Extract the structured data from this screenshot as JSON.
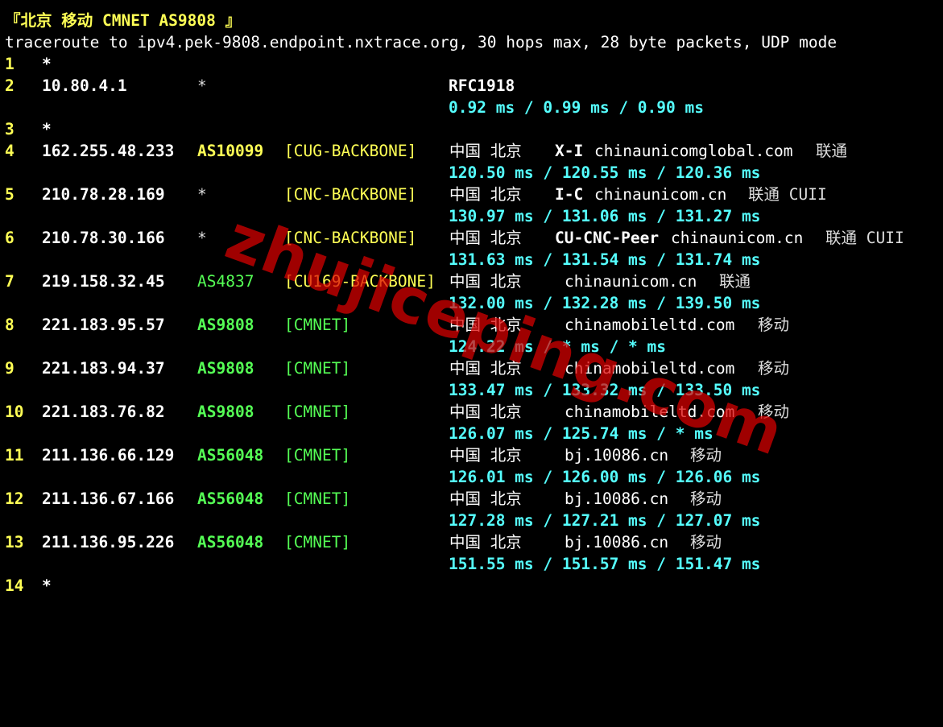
{
  "title": "『北京 移动 CMNET AS9808 』",
  "command": "traceroute to ipv4.pek-9808.endpoint.nxtrace.org, 30 hops max, 28 byte packets, UDP mode",
  "watermark": "zhujiceping.com",
  "colors": {
    "background": "#000000",
    "title": "#ffff55",
    "hop_number": "#ffff55",
    "ip": "#ffffff",
    "asn_yellow": "#ffff55",
    "asn_green": "#55ff55",
    "rtt": "#55ffff",
    "watermark": "#dc0000"
  },
  "hops": [
    {
      "num": "1",
      "ip": "*"
    },
    {
      "num": "2",
      "ip": "10.80.4.1",
      "asn": "*",
      "geo": "RFC1918",
      "rtt": "0.92 ms / 0.99 ms / 0.90 ms"
    },
    {
      "num": "3",
      "ip": "*"
    },
    {
      "num": "4",
      "ip": "162.255.48.233",
      "asn": "AS10099",
      "tag": "[CUG-BACKBONE]",
      "geo": "中国 北京",
      "host_bold": "X-I",
      "host": "chinaunicomglobal.com",
      "isp": "联通",
      "rtt": "120.50 ms / 120.55 ms / 120.36 ms"
    },
    {
      "num": "5",
      "ip": "210.78.28.169",
      "asn": "*",
      "tag": "[CNC-BACKBONE]",
      "geo": "中国 北京",
      "host_bold": "I-C",
      "host": "chinaunicom.cn",
      "isp": "联通 CUII",
      "rtt": "130.97 ms / 131.06 ms / 131.27 ms"
    },
    {
      "num": "6",
      "ip": "210.78.30.166",
      "asn": "*",
      "tag": "[CNC-BACKBONE]",
      "geo": "中国 北京",
      "host_bold": "CU-CNC-Peer",
      "host": "chinaunicom.cn",
      "isp": "联通 CUII",
      "rtt": "131.63 ms / 131.54 ms / 131.74 ms"
    },
    {
      "num": "7",
      "ip": "219.158.32.45",
      "asn": "AS4837",
      "tag": "[CU169-BACKBONE]",
      "geo": "中国 北京",
      "host": "chinaunicom.cn",
      "isp": "联通",
      "rtt": "132.00 ms / 132.28 ms / 139.50 ms"
    },
    {
      "num": "8",
      "ip": "221.183.95.57",
      "asn": "AS9808",
      "tag": "[CMNET]",
      "geo": "中国 北京",
      "host": "chinamobileltd.com",
      "isp": "移动",
      "rtt": "124.22 ms / * ms / * ms"
    },
    {
      "num": "9",
      "ip": "221.183.94.37",
      "asn": "AS9808",
      "tag": "[CMNET]",
      "geo": "中国 北京",
      "host": "chinamobileltd.com",
      "isp": "移动",
      "rtt": "133.47 ms / 133.32 ms / 133.50 ms"
    },
    {
      "num": "10",
      "ip": "221.183.76.82",
      "asn": "AS9808",
      "tag": "[CMNET]",
      "geo": "中国 北京",
      "host": "chinamobileltd.com",
      "isp": "移动",
      "rtt": "126.07 ms / 125.74 ms / * ms"
    },
    {
      "num": "11",
      "ip": "211.136.66.129",
      "asn": "AS56048",
      "tag": "[CMNET]",
      "geo": "中国 北京",
      "host": "bj.10086.cn",
      "isp": "移动",
      "rtt": "126.01 ms / 126.00 ms / 126.06 ms"
    },
    {
      "num": "12",
      "ip": "211.136.67.166",
      "asn": "AS56048",
      "tag": "[CMNET]",
      "geo": "中国 北京",
      "host": "bj.10086.cn",
      "isp": "移动",
      "rtt": "127.28 ms / 127.21 ms / 127.07 ms"
    },
    {
      "num": "13",
      "ip": "211.136.95.226",
      "asn": "AS56048",
      "tag": "[CMNET]",
      "geo": "中国 北京",
      "host": "bj.10086.cn",
      "isp": "移动",
      "rtt": "151.55 ms / 151.57 ms / 151.47 ms"
    },
    {
      "num": "14",
      "ip": "*"
    }
  ]
}
